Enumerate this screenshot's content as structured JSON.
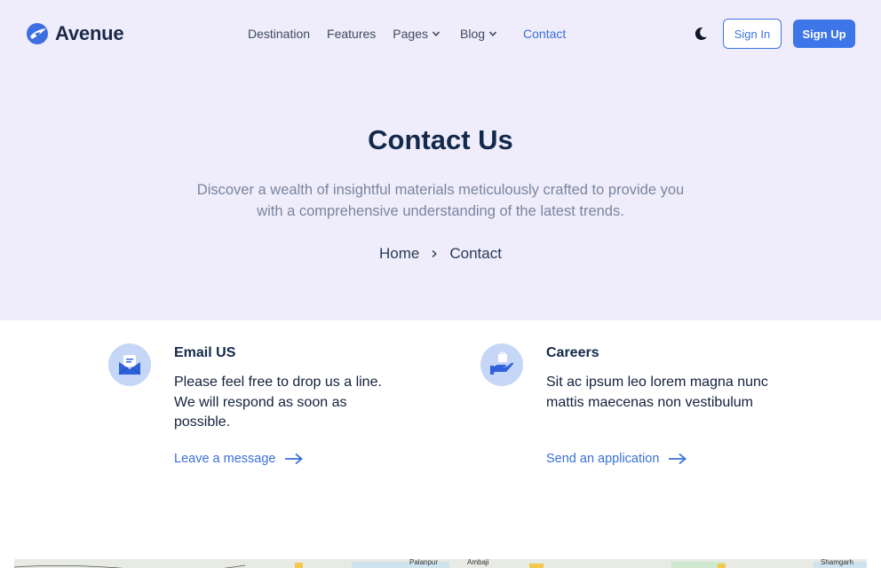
{
  "brand": {
    "name": "Avenue"
  },
  "nav": {
    "items": [
      {
        "label": "Destination"
      },
      {
        "label": "Features"
      },
      {
        "label": "Pages"
      },
      {
        "label": "Blog"
      },
      {
        "label": "Contact"
      }
    ]
  },
  "header": {
    "signin_label": "Sign In",
    "signup_label": "Sign Up"
  },
  "hero": {
    "title": "Contact Us",
    "subtitle": "Discover a wealth of insightful materials meticulously crafted to provide you with a comprehensive understanding of the latest trends.",
    "breadcrumb": {
      "home": "Home",
      "current": "Contact"
    }
  },
  "cards": {
    "email": {
      "title": "Email US",
      "text": "Please feel free to drop us a line. We will respond as soon as possible.",
      "link": "Leave a message",
      "icon": "envelope-icon"
    },
    "careers": {
      "title": "Careers",
      "text": "Sit ac ipsum leo lorem magna nunc mattis maecenas non vestibulum",
      "link": "Send an application",
      "icon": "hand-briefcase-icon"
    }
  },
  "map": {
    "labels": [
      "Palanpur",
      "Ambaji",
      "Shamgarh"
    ]
  },
  "colors": {
    "accent": "#3e76e9",
    "hero_bg": "#efedfb",
    "title": "#13294b",
    "muted": "#7a859e",
    "icon_circle": "#c5d6f7"
  }
}
